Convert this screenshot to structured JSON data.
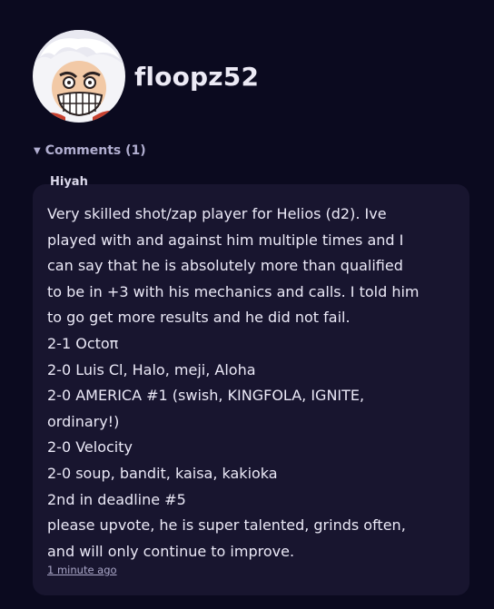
{
  "profile": {
    "username": "floopz52",
    "avatar_icon": "avatar-image"
  },
  "comments": {
    "toggle_label": "Comments (1)",
    "caret_icon": "▼",
    "items": [
      {
        "author": "Hiyah",
        "lines": [
          "Very skilled shot/zap player for Helios (d2). Ive",
          "played with and against him multiple times and I",
          "can say that he is absolutely more than qualified",
          "to be in +3 with his mechanics and calls. I told him",
          "to go get more results and he did not fail.",
          "2-1 Octoπ",
          "2-0 Luis Cl, Halo, meji, Aloha",
          "2-0 AMERICA #1 (swish, KINGFOLA, IGNITE,",
          "ordinary!)",
          "2-0 Velocity",
          "2-0 soup, bandit, kaisa, kakioka",
          "2nd in deadline #5",
          "please upvote, he is super talented, grinds often,",
          "and will only continue to improve."
        ],
        "timestamp": "1 minute ago"
      }
    ]
  },
  "colors": {
    "background": "#0b0a1f",
    "card": "#18152f",
    "text": "#ebe9f7",
    "muted": "#b1aed0"
  }
}
